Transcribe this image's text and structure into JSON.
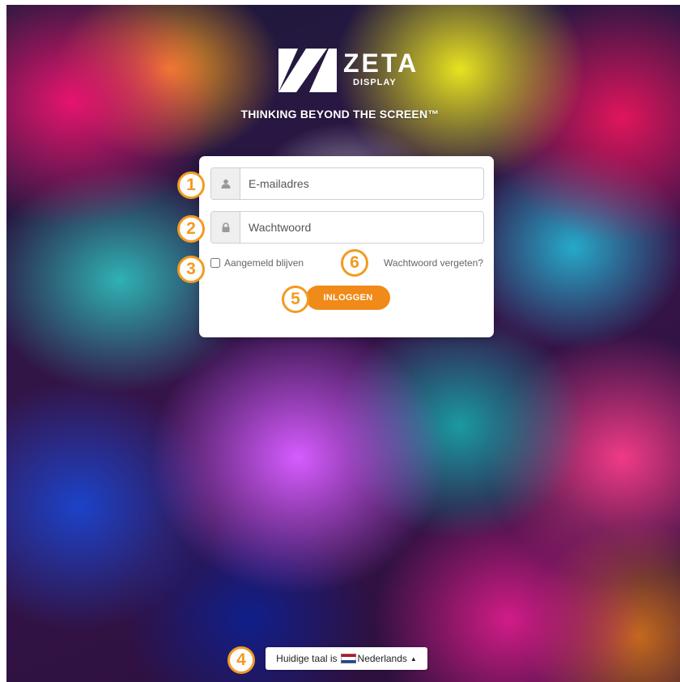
{
  "brand": {
    "name": "ZETA",
    "sub": "DISPLAY",
    "tagline": "THINKING BEYOND THE SCREEN™"
  },
  "login": {
    "email_placeholder": "E-mailadres",
    "password_placeholder": "Wachtwoord",
    "remember_label": "Aangemeld blijven",
    "remember_checked": false,
    "forgot_label": "Wachtwoord vergeten?",
    "submit_label": "INLOGGEN"
  },
  "language": {
    "prefix": "Huidige taal is",
    "current": "Nederlands"
  },
  "markers": [
    "1",
    "2",
    "3",
    "4",
    "5",
    "6"
  ],
  "colors": {
    "accent": "#f08a18",
    "marker": "#f39a20"
  },
  "icons": {
    "email": "user-icon",
    "password": "lock-icon",
    "flag": "netherlands-flag-icon",
    "caret": "caret-up-icon"
  }
}
